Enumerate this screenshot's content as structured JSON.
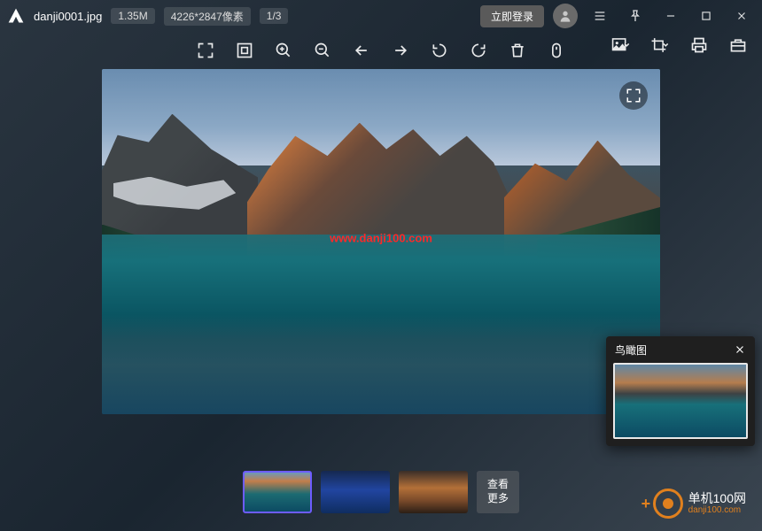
{
  "titlebar": {
    "filename": "danji0001.jpg",
    "filesize": "1.35M",
    "dimensions": "4226*2847像素",
    "index": "1/3",
    "login_label": "立即登录"
  },
  "watermark": "www.danji100.com",
  "birdseye": {
    "title": "鸟瞰图"
  },
  "thumbs": {
    "more_line1": "查看",
    "more_line2": "更多"
  },
  "site": {
    "cn": "单机100网",
    "en": "danji100.com"
  }
}
